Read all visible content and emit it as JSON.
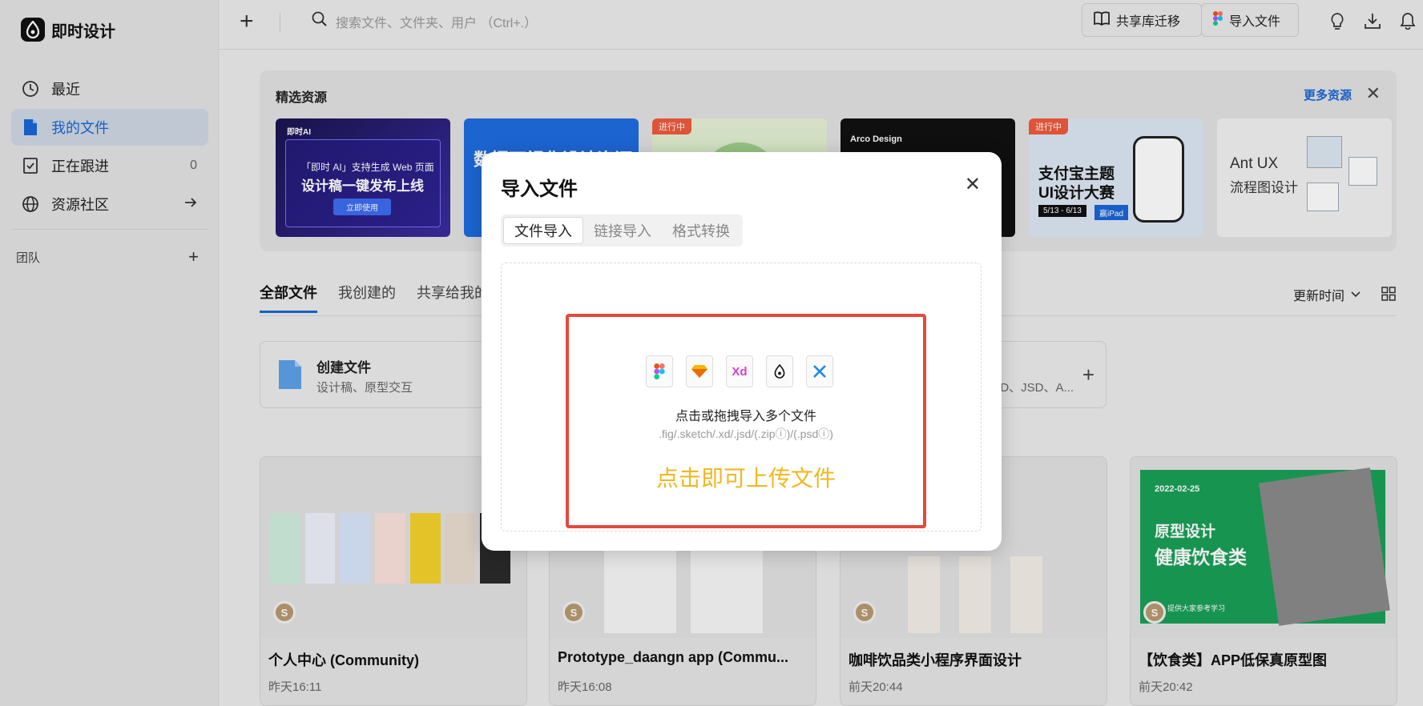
{
  "app": {
    "name": "即时设计"
  },
  "sidebar": {
    "items": [
      {
        "label": "最近",
        "icon": "clock-icon"
      },
      {
        "label": "我的文件",
        "icon": "document-icon"
      },
      {
        "label": "正在跟进",
        "icon": "follow-icon",
        "count": "0"
      },
      {
        "label": "资源社区",
        "icon": "globe-icon"
      }
    ],
    "team_label": "团队"
  },
  "topbar": {
    "search_placeholder": "搜索文件、文件夹、用户 （Ctrl+.）",
    "share_lib_label": "共享库迁移",
    "import_label": "导入文件"
  },
  "featured": {
    "title": "精选资源",
    "more": "更多资源",
    "cards": [
      {
        "line1": "「即时 AI」支持生成 Web 页面",
        "line2": "设计稿一键发布上线",
        "btn": "立即使用",
        "brand": "即时AI"
      },
      {
        "text": "数据可视化设计资源"
      },
      {
        "tag": "进行中"
      },
      {
        "brand": "Arco Design"
      },
      {
        "tag": "进行中",
        "line1": "支付宝主题",
        "line2": "UI设计大赛",
        "date": "5/13 - 6/13",
        "prize": "赢iPad"
      },
      {
        "line1": "Ant UX",
        "line2": "流程图设计"
      }
    ]
  },
  "tabs": [
    "全部文件",
    "我创建的",
    "共享给我的"
  ],
  "sort_label": "更新时间",
  "create": {
    "title": "创建文件",
    "sub": "设计稿、原型交互",
    "right_text": "D、JSD、A..."
  },
  "files": [
    {
      "name": "个人中心 (Community)",
      "time": "昨天16:11",
      "avatar": "S"
    },
    {
      "name": "Prototype_daangn app (Commu...",
      "time": "昨天16:08",
      "avatar": "S"
    },
    {
      "name": "咖啡饮品类小程序界面设计",
      "time": "前天20:44",
      "avatar": "S"
    },
    {
      "name": "【饮食类】APP低保真原型图",
      "time": "前天20:42",
      "avatar": "S",
      "thumb_date": "2022-02-25",
      "thumb_line1": "原型设计",
      "thumb_line2": "健康饮食类",
      "thumb_note": "提供大家参考学习"
    }
  ],
  "modal": {
    "title": "导入文件",
    "tabs": [
      "文件导入",
      "链接导入",
      "格式转换"
    ],
    "drop_text": "点击或拖拽导入多个文件",
    "formats": ".fig/.sketch/.xd/.jsd/(.zipⓘ)/(.psdⓘ)",
    "cta": "点击即可上传文件",
    "file_icons": [
      "figma-icon",
      "sketch-icon",
      "xd-icon",
      "jsd-icon",
      "axure-icon"
    ],
    "xd_label": "Xd"
  },
  "colors": {
    "accent": "#1a66d6",
    "highlight": "#e5483d",
    "cta": "#f2b720"
  }
}
